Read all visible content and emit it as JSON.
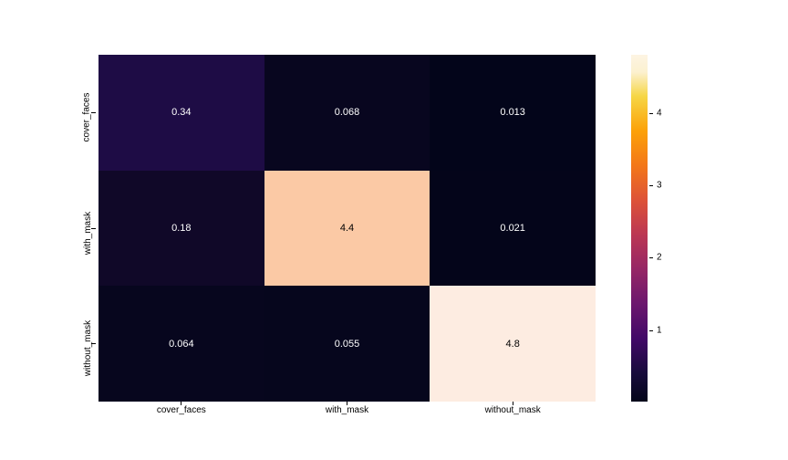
{
  "chart_data": {
    "type": "heatmap",
    "x_labels": [
      "cover_faces",
      "with_mask",
      "without_mask"
    ],
    "y_labels": [
      "cover_faces",
      "with_mask",
      "without_mask"
    ],
    "values": [
      [
        0.34,
        0.068,
        0.013
      ],
      [
        0.18,
        4.4,
        0.021
      ],
      [
        0.064,
        0.055,
        4.8
      ]
    ],
    "value_text": [
      [
        "0.34",
        "0.068",
        "0.013"
      ],
      [
        "0.18",
        "4.4",
        "0.021"
      ],
      [
        "0.064",
        "0.055",
        "4.8"
      ]
    ],
    "cell_colors": [
      [
        "#1e0c45",
        "#08061f",
        "#03051a"
      ],
      [
        "#100828",
        "#fbc9a5",
        "#04051a"
      ],
      [
        "#07061e",
        "#06061d",
        "#fdece1"
      ]
    ],
    "cell_text_class": [
      [
        "cell-text-light",
        "cell-text-light",
        "cell-text-light"
      ],
      [
        "cell-text-light",
        "cell-text-dark",
        "cell-text-light"
      ],
      [
        "cell-text-light",
        "cell-text-light",
        "cell-text-dark"
      ]
    ],
    "colorbar": {
      "ticks": [
        1,
        2,
        3,
        4
      ],
      "min": 0.013,
      "max": 4.8
    }
  }
}
